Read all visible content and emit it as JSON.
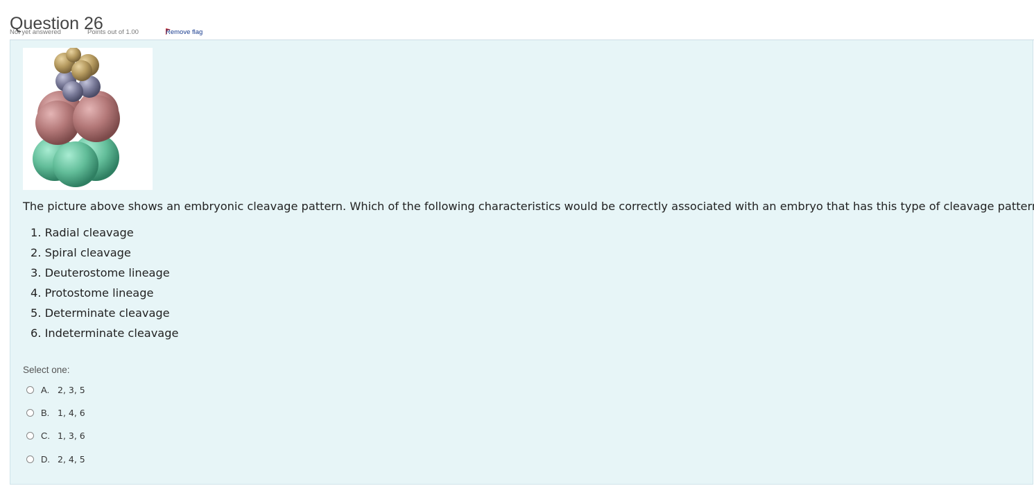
{
  "question": {
    "title": "Question 26",
    "status": "Not yet answered",
    "points": "Points out of 1.00",
    "flag_label": "Remove flag",
    "prompt": "The picture above shows an embryonic cleavage pattern. Which of the following characteristics would be correctly associated with an embryo that has this type of cleavage pattern?",
    "options": [
      "1. Radial cleavage",
      "2. Spiral cleavage",
      "3. Deuterostome lineage",
      "4. Protostome lineage",
      "5. Determinate cleavage",
      "6. Indeterminate cleavage"
    ],
    "select_label": "Select one:",
    "answers": [
      {
        "letter": "A.",
        "text": "2, 3, 5"
      },
      {
        "letter": "B.",
        "text": "1, 4, 6"
      },
      {
        "letter": "C.",
        "text": "1, 3, 6"
      },
      {
        "letter": "D.",
        "text": "2, 4, 5"
      }
    ]
  },
  "colors": {
    "panel_bg": "#e7f5f7",
    "flag": "#d0312d",
    "link": "#1a3d8f"
  },
  "icons": {
    "flag": "flag-icon",
    "radio": "radio-button"
  }
}
